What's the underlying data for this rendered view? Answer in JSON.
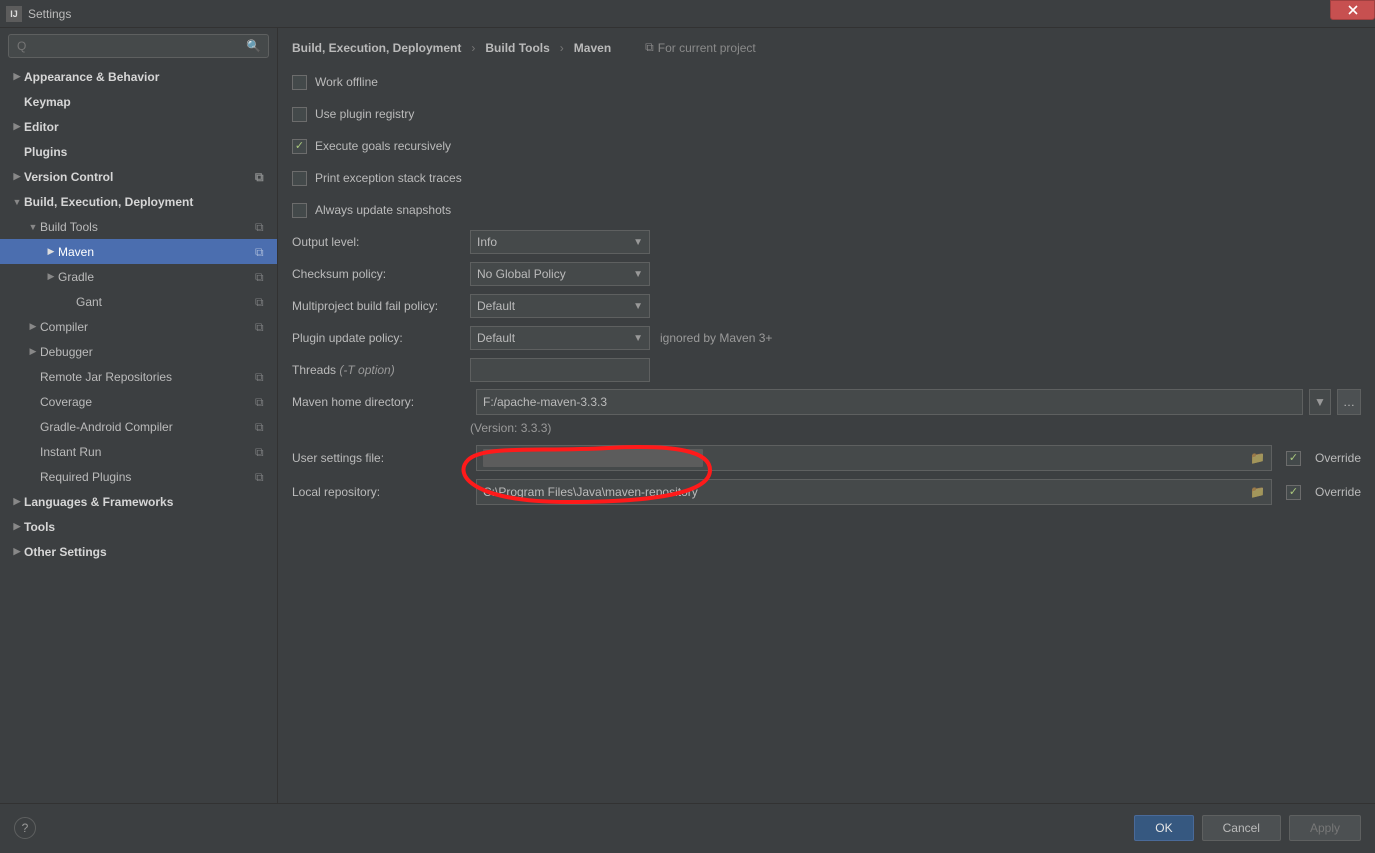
{
  "window": {
    "title": "Settings"
  },
  "search": {
    "placeholder": "Q"
  },
  "sidebar": {
    "items": [
      {
        "label": "Appearance & Behavior",
        "bold": true,
        "arrow": "right",
        "indent": 0
      },
      {
        "label": "Keymap",
        "bold": true,
        "arrow": "",
        "indent": 0
      },
      {
        "label": "Editor",
        "bold": true,
        "arrow": "right",
        "indent": 0
      },
      {
        "label": "Plugins",
        "bold": true,
        "arrow": "",
        "indent": 0
      },
      {
        "label": "Version Control",
        "bold": true,
        "arrow": "right",
        "indent": 0,
        "copy": true
      },
      {
        "label": "Build, Execution, Deployment",
        "bold": true,
        "arrow": "down",
        "indent": 0
      },
      {
        "label": "Build Tools",
        "bold": false,
        "arrow": "down",
        "indent": 1,
        "copy": true
      },
      {
        "label": "Maven",
        "bold": false,
        "arrow": "right",
        "indent": 2,
        "copy": true,
        "selected": true
      },
      {
        "label": "Gradle",
        "bold": false,
        "arrow": "right",
        "indent": 2,
        "copy": true
      },
      {
        "label": "Gant",
        "bold": false,
        "arrow": "",
        "indent": 3,
        "copy": true
      },
      {
        "label": "Compiler",
        "bold": false,
        "arrow": "right",
        "indent": 1,
        "copy": true
      },
      {
        "label": "Debugger",
        "bold": false,
        "arrow": "right",
        "indent": 1
      },
      {
        "label": "Remote Jar Repositories",
        "bold": false,
        "arrow": "",
        "indent": 1,
        "copy": true
      },
      {
        "label": "Coverage",
        "bold": false,
        "arrow": "",
        "indent": 1,
        "copy": true
      },
      {
        "label": "Gradle-Android Compiler",
        "bold": false,
        "arrow": "",
        "indent": 1,
        "copy": true
      },
      {
        "label": "Instant Run",
        "bold": false,
        "arrow": "",
        "indent": 1,
        "copy": true
      },
      {
        "label": "Required Plugins",
        "bold": false,
        "arrow": "",
        "indent": 1,
        "copy": true
      },
      {
        "label": "Languages & Frameworks",
        "bold": true,
        "arrow": "right",
        "indent": 0
      },
      {
        "label": "Tools",
        "bold": true,
        "arrow": "right",
        "indent": 0
      },
      {
        "label": "Other Settings",
        "bold": true,
        "arrow": "right",
        "indent": 0
      }
    ]
  },
  "breadcrumb": {
    "c1": "Build, Execution, Deployment",
    "c2": "Build Tools",
    "c3": "Maven",
    "hint": "For current project"
  },
  "checks": {
    "work_offline": "Work offline",
    "use_plugin": "Use plugin registry",
    "exec_goals": "Execute goals recursively",
    "print_stack": "Print exception stack traces",
    "always_update": "Always update snapshots"
  },
  "labels": {
    "output_level": "Output level:",
    "checksum": "Checksum policy:",
    "multiproject": "Multiproject build fail policy:",
    "plugin_update": "Plugin update policy:",
    "threads_pre": "Threads ",
    "threads_hint": "(-T option)",
    "maven_home": "Maven home directory:",
    "user_settings": "User settings file:",
    "local_repo": "Local repository:",
    "override": "Override"
  },
  "values": {
    "output_level": "Info",
    "checksum": "No Global Policy",
    "multiproject": "Default",
    "plugin_update": "Default",
    "plugin_update_note": "ignored by Maven 3+",
    "maven_home": "F:/apache-maven-3.3.3",
    "version_hint": "(Version: 3.3.3)",
    "local_repo": "C:\\Program Files\\Java\\maven-repository",
    "override1": true,
    "override2": true
  },
  "footer": {
    "ok": "OK",
    "cancel": "Cancel",
    "apply": "Apply",
    "help": "?"
  }
}
